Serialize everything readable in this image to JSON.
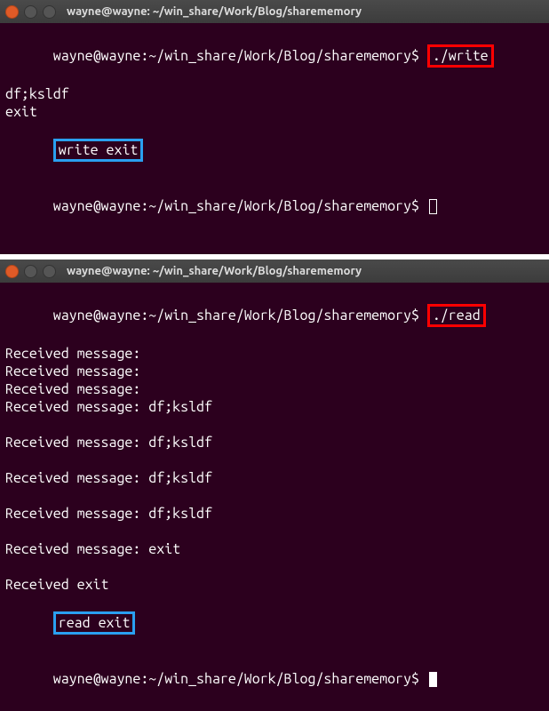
{
  "top": {
    "title": "wayne@wayne: ~/win_share/Work/Blog/sharememory",
    "prompt": "wayne@wayne:~/win_share/Work/Blog/sharememory$ ",
    "cmd": "./write",
    "lines": [
      "df;ksldf",
      "exit"
    ],
    "boxed": "write exit"
  },
  "bottom": {
    "title": "wayne@wayne: ~/win_share/Work/Blog/sharememory",
    "prompt": "wayne@wayne:~/win_share/Work/Blog/sharememory$ ",
    "cmd": "./read",
    "lines1": [
      "Received message:",
      "Received message:",
      "Received message:",
      "Received message: df;ksldf"
    ],
    "lines2": [
      "Received message: df;ksldf"
    ],
    "lines3": [
      "Received message: df;ksldf"
    ],
    "lines4": [
      "Received message: df;ksldf"
    ],
    "lines5": [
      "Received message: exit"
    ],
    "received_exit": "Received exit",
    "boxed": "read exit"
  }
}
